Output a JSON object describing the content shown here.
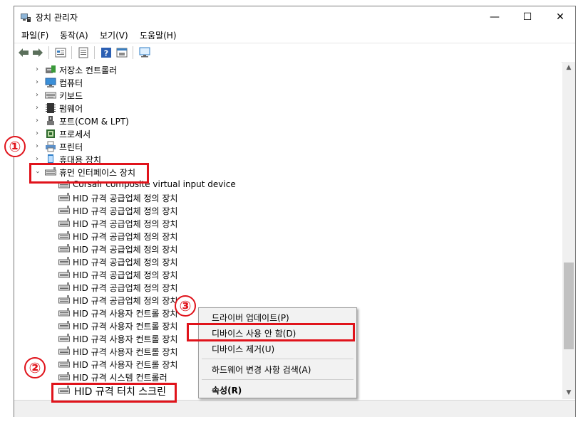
{
  "window": {
    "title": "장치 관리자",
    "controls": {
      "minimize": "—",
      "maximize": "☐",
      "close": "✕"
    }
  },
  "menu": [
    "파일(F)",
    "동작(A)",
    "보기(V)",
    "도움말(H)"
  ],
  "toolbar_icons": [
    "back-arrow-icon",
    "forward-arrow-icon",
    "properties-icon",
    "list-icon",
    "help-icon",
    "run-icon",
    "monitor-icon"
  ],
  "tree": {
    "categories_top": [
      {
        "label": "저장소 컨트롤러",
        "icon": "storage-controller-icon"
      },
      {
        "label": "컴퓨터",
        "icon": "computer-icon"
      },
      {
        "label": "키보드",
        "icon": "keyboard-icon"
      },
      {
        "label": "펌웨어",
        "icon": "firmware-icon"
      },
      {
        "label": "포트(COM & LPT)",
        "icon": "port-icon"
      },
      {
        "label": "프로세서",
        "icon": "processor-icon"
      },
      {
        "label": "프린터",
        "icon": "printer-icon"
      },
      {
        "label": "휴대용 장치",
        "icon": "portable-device-icon"
      }
    ],
    "expanded": {
      "label": "휴먼 인터페이스 장치",
      "icon": "hid-icon"
    },
    "children": [
      "Corsair composite virtual input device",
      "HID 규격 공급업체 정의 장치",
      "HID 규격 공급업체 정의 장치",
      "HID 규격 공급업체 정의 장치",
      "HID 규격 공급업체 정의 장치",
      "HID 규격 공급업체 정의 장치",
      "HID 규격 공급업체 정의 장치",
      "HID 규격 공급업체 정의 장치",
      "HID 규격 공급업체 정의 장치",
      "HID 규격 공급업체 정의 장치",
      "HID 규격 사용자 컨트롤 장치",
      "HID 규격 사용자 컨트롤 장치",
      "HID 규격 사용자 컨트롤 장치",
      "HID 규격 사용자 컨트롤 장치",
      "HID 규격 사용자 컨트롤 장치",
      "HID 규격 시스템 컨트롤러"
    ],
    "selected_child": "HID 규격 터치 스크린"
  },
  "context_menu": {
    "items": [
      "드라이버 업데이트(P)",
      "디바이스 사용 안 함(D)",
      "디바이스 제거(U)",
      "하드웨어 변경 사항 검색(A)",
      "속성(R)"
    ]
  },
  "annotations": {
    "step1": "①",
    "step2": "②",
    "step3": "③"
  },
  "colors": {
    "highlight": "#e0131b",
    "menu_bg": "#f2f2f2"
  }
}
